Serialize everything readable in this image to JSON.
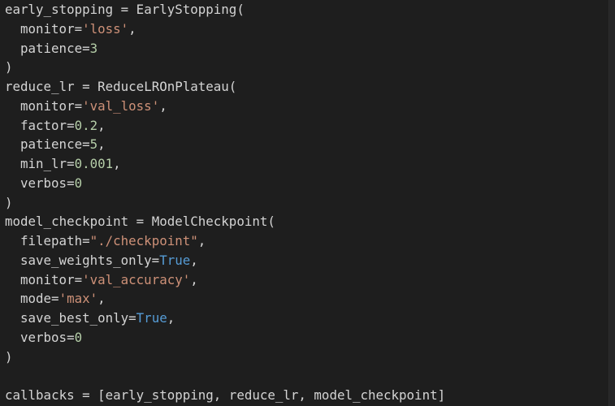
{
  "lines": [
    {
      "indent": false,
      "tokens": [
        {
          "t": "plain",
          "v": "early_stopping = EarlyStopping("
        }
      ]
    },
    {
      "indent": true,
      "tokens": [
        {
          "t": "plain",
          "v": "monitor="
        },
        {
          "t": "str",
          "v": "'loss'"
        },
        {
          "t": "plain",
          "v": ","
        }
      ]
    },
    {
      "indent": true,
      "tokens": [
        {
          "t": "plain",
          "v": "patience="
        },
        {
          "t": "num",
          "v": "3"
        }
      ]
    },
    {
      "indent": false,
      "tokens": [
        {
          "t": "plain",
          "v": ")"
        }
      ]
    },
    {
      "indent": false,
      "tokens": [
        {
          "t": "plain",
          "v": "reduce_lr = ReduceLROnPlateau("
        }
      ]
    },
    {
      "indent": true,
      "tokens": [
        {
          "t": "plain",
          "v": "monitor="
        },
        {
          "t": "str",
          "v": "'val_loss'"
        },
        {
          "t": "plain",
          "v": ","
        }
      ]
    },
    {
      "indent": true,
      "tokens": [
        {
          "t": "plain",
          "v": "factor="
        },
        {
          "t": "num",
          "v": "0.2"
        },
        {
          "t": "plain",
          "v": ","
        }
      ]
    },
    {
      "indent": true,
      "tokens": [
        {
          "t": "plain",
          "v": "patience="
        },
        {
          "t": "num",
          "v": "5"
        },
        {
          "t": "plain",
          "v": ","
        }
      ]
    },
    {
      "indent": true,
      "tokens": [
        {
          "t": "plain",
          "v": "min_lr="
        },
        {
          "t": "num",
          "v": "0.001"
        },
        {
          "t": "plain",
          "v": ","
        }
      ]
    },
    {
      "indent": true,
      "tokens": [
        {
          "t": "plain",
          "v": "verbos="
        },
        {
          "t": "num",
          "v": "0"
        }
      ]
    },
    {
      "indent": false,
      "tokens": [
        {
          "t": "plain",
          "v": ")"
        }
      ]
    },
    {
      "indent": false,
      "tokens": [
        {
          "t": "plain",
          "v": "model_checkpoint = ModelCheckpoint("
        }
      ]
    },
    {
      "indent": true,
      "tokens": [
        {
          "t": "plain",
          "v": "filepath="
        },
        {
          "t": "str",
          "v": "\"./checkpoint\""
        },
        {
          "t": "plain",
          "v": ","
        }
      ]
    },
    {
      "indent": true,
      "tokens": [
        {
          "t": "plain",
          "v": "save_weights_only="
        },
        {
          "t": "kw",
          "v": "True"
        },
        {
          "t": "plain",
          "v": ","
        }
      ]
    },
    {
      "indent": true,
      "tokens": [
        {
          "t": "plain",
          "v": "monitor="
        },
        {
          "t": "str",
          "v": "'val_accuracy'"
        },
        {
          "t": "plain",
          "v": ","
        }
      ]
    },
    {
      "indent": true,
      "tokens": [
        {
          "t": "plain",
          "v": "mode="
        },
        {
          "t": "str",
          "v": "'max'"
        },
        {
          "t": "plain",
          "v": ","
        }
      ]
    },
    {
      "indent": true,
      "tokens": [
        {
          "t": "plain",
          "v": "save_best_only="
        },
        {
          "t": "kw",
          "v": "True"
        },
        {
          "t": "plain",
          "v": ","
        }
      ]
    },
    {
      "indent": true,
      "tokens": [
        {
          "t": "plain",
          "v": "verbos="
        },
        {
          "t": "num",
          "v": "0"
        }
      ]
    },
    {
      "indent": false,
      "tokens": [
        {
          "t": "plain",
          "v": ")"
        }
      ]
    },
    {
      "indent": false,
      "tokens": []
    },
    {
      "indent": false,
      "tokens": [
        {
          "t": "plain",
          "v": "callbacks = [early_stopping, reduce_lr, model_checkpoint]"
        }
      ]
    }
  ],
  "colors": {
    "background": "#1e1e1e",
    "default_text": "#d4d4d4",
    "string": "#ce9178",
    "number": "#b5cea8",
    "keyword": "#569cd6"
  }
}
